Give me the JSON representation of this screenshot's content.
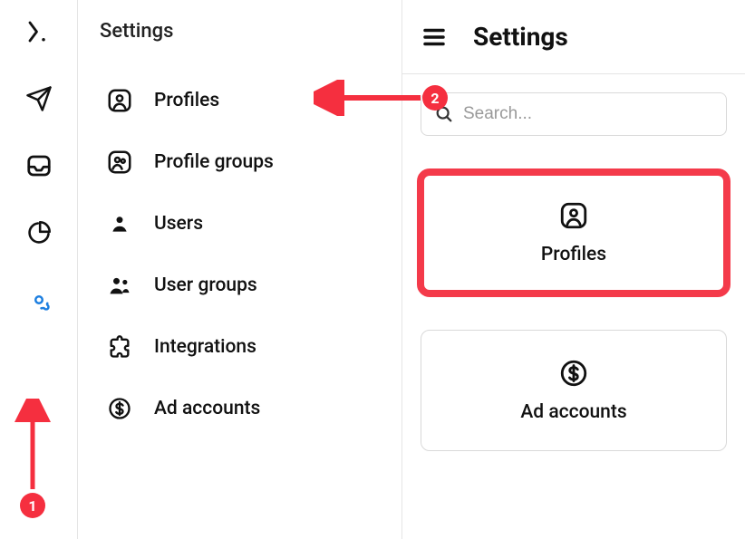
{
  "rail": {
    "icons": [
      "logo",
      "send",
      "inbox",
      "pie",
      "settings"
    ]
  },
  "nav": {
    "title": "Settings",
    "items": [
      {
        "label": "Profiles"
      },
      {
        "label": "Profile groups"
      },
      {
        "label": "Users"
      },
      {
        "label": "User groups"
      },
      {
        "label": "Integrations"
      },
      {
        "label": "Ad accounts"
      }
    ]
  },
  "panel": {
    "title": "Settings",
    "search_placeholder": "Search..."
  },
  "cards": [
    {
      "label": "Profiles"
    },
    {
      "label": "Ad accounts"
    }
  ],
  "annotations": {
    "badge1": "1",
    "badge2": "2"
  }
}
